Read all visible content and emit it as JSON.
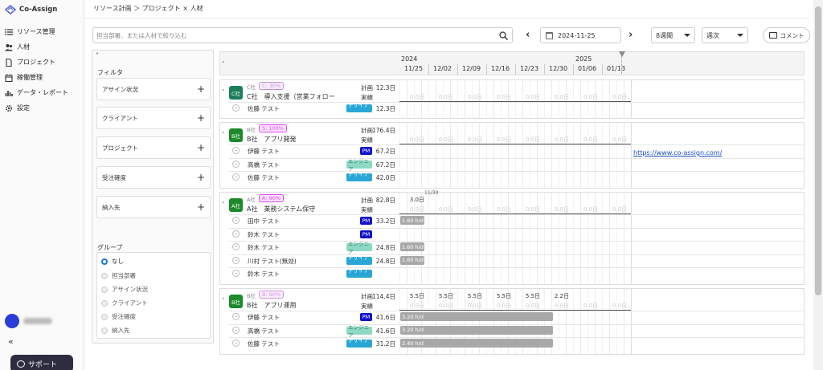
{
  "app": {
    "name": "Co-Assign"
  },
  "nav": [
    {
      "label": "リソース管理",
      "icon": "list-icon"
    },
    {
      "label": "人材",
      "icon": "people-icon"
    },
    {
      "label": "プロジェクト",
      "icon": "document-icon"
    },
    {
      "label": "稼働管理",
      "icon": "calendar-icon"
    },
    {
      "label": "データ・レポート",
      "icon": "bar-chart-icon"
    },
    {
      "label": "設定",
      "icon": "gear-icon"
    }
  ],
  "sidebar": {
    "collapse": "«",
    "support": "サポート"
  },
  "breadcrumb": "リソース計画 ＞ プロジェクト × 人材",
  "search": {
    "placeholder": "担当部署、または人材で絞り込む"
  },
  "toolbar": {
    "prev": "‹",
    "next": "›",
    "date": "2024-11-25",
    "range": "8週間",
    "unit": "週次",
    "comment": "コメント"
  },
  "filter": {
    "collapse": "˅",
    "title": "フィルタ",
    "items": [
      "アサイン状況",
      "クライアント",
      "プロジェクト",
      "受注確度",
      "納入先"
    ],
    "plus": "+",
    "group_title": "グループ",
    "group_options": [
      "なし",
      "担当部署",
      "アサイン状況",
      "クライアント",
      "受注確度",
      "納入先"
    ],
    "group_selected": 0
  },
  "timeline": {
    "caret": "˅",
    "years": [
      {
        "label": "2024"
      },
      {
        "label": "2025"
      }
    ],
    "weeks": [
      "11/25",
      "12/02",
      "12/09",
      "12/16",
      "12/23",
      "12/30",
      "01/06",
      "01/13"
    ]
  },
  "projects": [
    {
      "logo": "C社",
      "logo_color": "#1a7f5a",
      "client": "C社",
      "prob": "C: 30%",
      "prob_color": "#c58be0",
      "name": "C社　導入支援（営業フォロー",
      "plan_label": "計画",
      "actual_label": "実績",
      "plan_total": "12.3日",
      "actual_row_cells": "0.0日",
      "plan_cells": [
        "",
        "",
        "",
        "",
        "",
        "",
        "",
        ""
      ],
      "members": [
        {
          "name": "佐藤 テスト",
          "role": "デザイナー",
          "role_type": "dz",
          "days": "12.3日",
          "bar": ""
        }
      ]
    },
    {
      "logo": "B社",
      "logo_color": "#1a8a2a",
      "client": "B社",
      "prob": "S: 100%",
      "prob_color": "#e040fb",
      "name": "B社　アプリ開発",
      "plan_label": "計画",
      "actual_label": "実績",
      "plan_total": "176.4日",
      "actual_row_cells": "0.0日",
      "plan_cells": [
        "",
        "",
        "",
        "",
        "",
        "",
        "",
        ""
      ],
      "members": [
        {
          "name": "伊藤 テスト",
          "role": "PM",
          "role_type": "pm",
          "days": "67.2日",
          "bar": ""
        },
        {
          "name": "高橋 テスト",
          "role": "エンジニア",
          "role_type": "en",
          "days": "67.2日",
          "bar": ""
        },
        {
          "name": "佐藤 テスト",
          "role": "デザイナー",
          "role_type": "dz",
          "days": "42.0日",
          "bar": ""
        }
      ],
      "link": "https://www.co-assign.com/"
    },
    {
      "logo": "A社",
      "logo_color": "#1a8a2a",
      "client": "A社",
      "prob": "A: 90%",
      "prob_color": "#e040fb",
      "name": "A社　業務システム保守",
      "plan_label": "計画",
      "actual_label": "実績",
      "plan_total": "82.8日",
      "actual_row_cells": "0.0日",
      "plan_cells": [
        "3.0日",
        "",
        "",
        "",
        "",
        "",
        "",
        ""
      ],
      "marker": "11/30",
      "members": [
        {
          "name": "田中 テスト",
          "role": "PM",
          "role_type": "pm",
          "days": "33.2日",
          "bar": "1.60 h/d"
        },
        {
          "name": "鈴木 テスト",
          "role": "PM",
          "role_type": "pm",
          "days": "",
          "bar": ""
        },
        {
          "name": "鈴木 テスト",
          "role": "エンジニア",
          "role_type": "en",
          "days": "24.8日",
          "bar": "1.60 h/d"
        },
        {
          "name": "川村 テスト(無効)",
          "role": "デザイナー",
          "role_type": "dz",
          "days": "24.8日",
          "bar": "1.60 h/d"
        },
        {
          "name": "鈴木 テスト",
          "role": "デザイナー",
          "role_type": "dz",
          "days": "",
          "bar": ""
        }
      ]
    },
    {
      "logo": "B社",
      "logo_color": "#1a8a2a",
      "client": "B社",
      "prob": "B: 60%",
      "prob_color": "#d88be8",
      "name": "B社　アプリ運用",
      "plan_label": "計画",
      "actual_label": "実績",
      "plan_total": "114.4日",
      "actual_row_cells": "0.0日",
      "plan_cells": [
        "5.5日",
        "5.5日",
        "5.5日",
        "5.5日",
        "5.5日",
        "2.2日",
        "",
        ""
      ],
      "members": [
        {
          "name": "伊藤 テスト",
          "role": "PM",
          "role_type": "pm",
          "days": "41.6日",
          "bar": "3.20 h/d"
        },
        {
          "name": "高橋 テスト",
          "role": "エンジニア",
          "role_type": "en",
          "days": "41.6日",
          "bar": "3.20 h/d"
        },
        {
          "name": "佐藤 テスト",
          "role": "デザイナー",
          "role_type": "dz",
          "days": "31.2日",
          "bar": "2.40 h/d"
        }
      ]
    }
  ]
}
